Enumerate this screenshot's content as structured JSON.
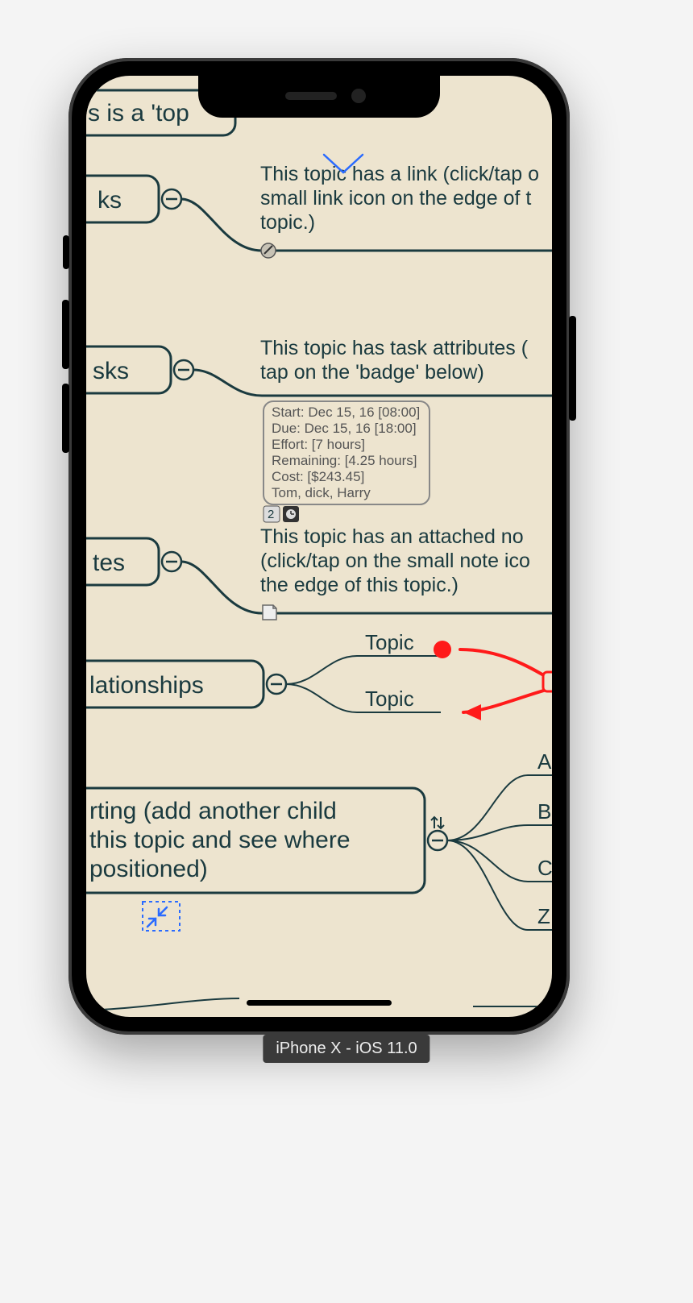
{
  "device_label": "iPhone X - iOS 11.0",
  "nodes": {
    "root": {
      "label": "s is a 'top"
    },
    "links": {
      "label": "ks",
      "desc_line1": "This topic has a link (click/tap o",
      "desc_line2": "small link icon on the edge of t",
      "desc_line3": "topic.)"
    },
    "tasks": {
      "label": "sks",
      "desc_line1": "This topic has task attributes (",
      "desc_line2": "tap on the 'badge' below)",
      "badge_lines": [
        "Start: Dec 15, 16 [08:00]",
        "Due: Dec 15, 16 [18:00]",
        "Effort: [7 hours]",
        "Remaining: [4.25 hours]",
        "Cost: [$243.45]",
        "Tom, dick, Harry"
      ],
      "badge_icon_number": "2"
    },
    "notes": {
      "label": "tes",
      "desc_line1": "This topic has an attached no",
      "desc_line2": "(click/tap on the small note ico",
      "desc_line3": "the edge of this topic.)"
    },
    "relationships": {
      "label": "lationships",
      "child1": "Topic",
      "child2": "Topic"
    },
    "sorting": {
      "line1": "rting (add another child",
      "line2": "this topic and see where",
      "line3": " positioned)",
      "child_a": "A",
      "child_b": "B",
      "child_c": "C",
      "child_z": "Z"
    }
  }
}
